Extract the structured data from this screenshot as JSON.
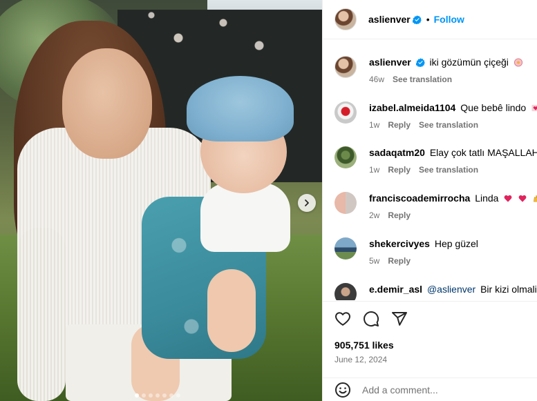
{
  "post": {
    "carousel_index": 1,
    "carousel_count": 7
  },
  "header": {
    "username": "aslienver",
    "separator": "•",
    "follow_label": "Follow"
  },
  "caption": {
    "username": "aslienver",
    "text": "iki gözümün çiçeği",
    "time": "46w",
    "see_translation": "See translation"
  },
  "comments": [
    {
      "username": "izabel.almeida1104",
      "text": "Que bebê lindo",
      "time": "1w",
      "reply": "Reply",
      "see_translation": "See translation"
    },
    {
      "username": "sadaqatm20",
      "text": "Elay çok tatlı MAŞALLAH.",
      "time": "1w",
      "reply": "Reply",
      "see_translation": "See translation"
    },
    {
      "username": "franciscoademirrocha",
      "text": "Linda",
      "time": "2w",
      "reply": "Reply"
    },
    {
      "username": "shekercivyes",
      "text": "Hep güzel",
      "time": "5w",
      "reply": "Reply"
    },
    {
      "username": "e.demir_asl",
      "mention": "@aslienver",
      "text": "Bir kizi olmali in"
    }
  ],
  "stats": {
    "likes": "905,751 likes",
    "date": "June 12, 2024"
  },
  "composer": {
    "placeholder": "Add a comment..."
  },
  "colors": {
    "accent": "#0095f6",
    "muted": "#737373",
    "mention": "#00376b",
    "heart_red": "#e0245e"
  },
  "icons": [
    "verified-badge-icon",
    "heart-icon",
    "comment-icon",
    "share-icon",
    "emoji-icon",
    "chevron-right-icon"
  ]
}
